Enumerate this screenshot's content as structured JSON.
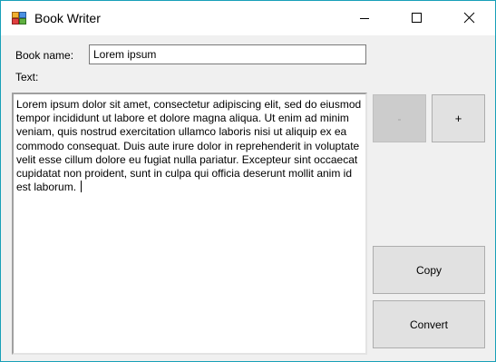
{
  "window": {
    "title": "Book Writer",
    "icon": "app-icon",
    "controls": {
      "minimize": "minimize-icon",
      "maximize": "maximize-icon",
      "close": "close-icon"
    }
  },
  "form": {
    "book_name_label": "Book name:",
    "book_name_value": "Lorem ipsum",
    "text_label": "Text:",
    "text_value": "Lorem ipsum dolor sit amet, consectetur adipiscing elit, sed do eiusmod tempor incididunt ut labore et dolore magna aliqua. Ut enim ad minim veniam, quis nostrud exercitation ullamco laboris nisi ut aliquip ex ea commodo consequat. Duis aute irure dolor in reprehenderit in voluptate velit esse cillum dolore eu fugiat nulla pariatur. Excepteur sint occaecat cupidatat non proident, sunt in culpa qui officia deserunt mollit anim id est laborum. "
  },
  "buttons": {
    "minus_label": "-",
    "minus_enabled": false,
    "plus_label": "+",
    "copy_label": "Copy",
    "convert_label": "Convert"
  },
  "colors": {
    "window_border": "#18a0b8",
    "window_background": "#f0f0f0",
    "button_face": "#e1e1e1",
    "button_disabled": "#cccccc"
  }
}
